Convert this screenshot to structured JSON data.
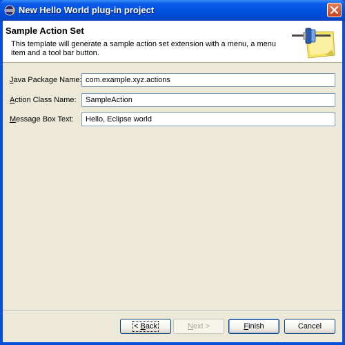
{
  "window": {
    "title": "New Hello World plug-in project",
    "icon": "eclipse-icon"
  },
  "header": {
    "title": "Sample Action Set",
    "description": "This template will generate a sample action set extension with a menu, a menu item and a tool bar button.",
    "image": "plugin-wizard-icon"
  },
  "form": {
    "package_label_mnemonic": "J",
    "package_label_rest": "ava Package Name:",
    "package_value": "com.example.xyz.actions",
    "class_label_mnemonic": "A",
    "class_label_rest": "ction Class Name:",
    "class_value": "SampleAction",
    "message_label_mnemonic": "M",
    "message_label_rest": "essage Box Text:",
    "message_value": "Hello, Eclipse world"
  },
  "buttons": {
    "back_mnemonic": "B",
    "back_prefix": "< ",
    "back_rest": "ack",
    "next_mnemonic": "N",
    "next_rest": "ext >",
    "finish_mnemonic": "F",
    "finish_rest": "inish",
    "cancel": "Cancel"
  },
  "colors": {
    "titlebar": "#0052e0",
    "dialog_bg": "#ece9d8",
    "close": "#c8401c"
  }
}
